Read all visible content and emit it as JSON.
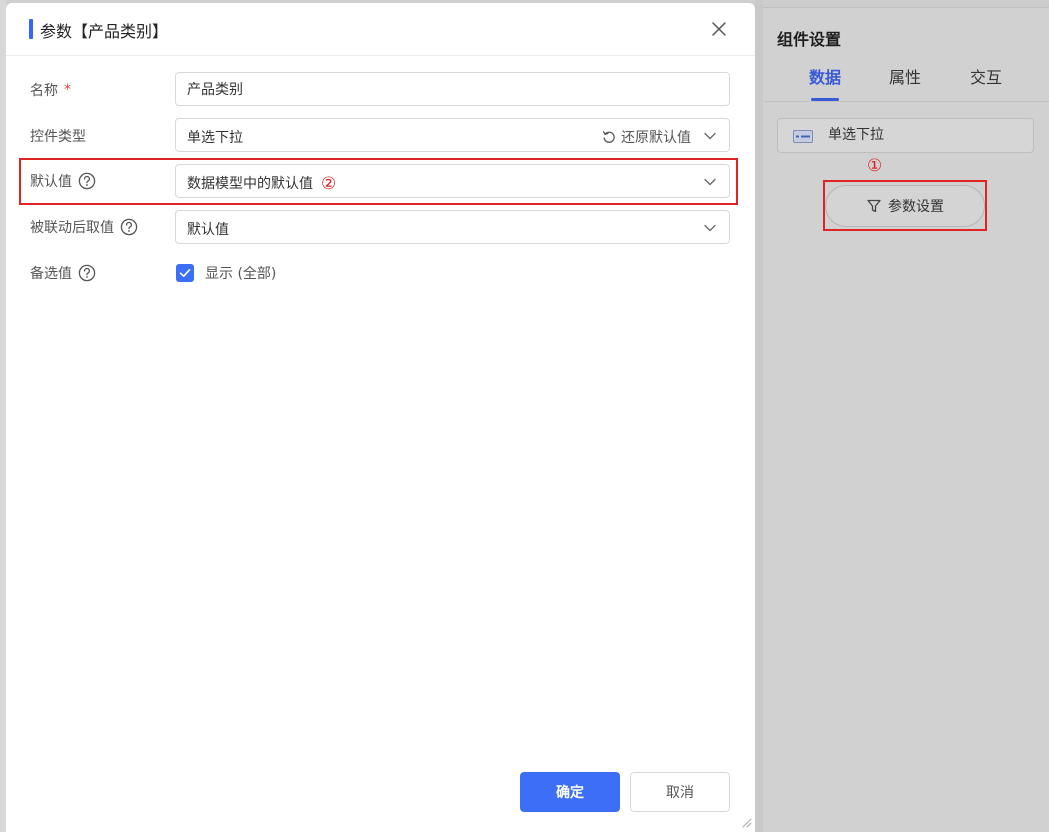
{
  "dialog": {
    "title": "参数【产品类别】",
    "fields": {
      "name": {
        "label": "名称",
        "required_mark": "*",
        "value": "产品类别"
      },
      "control_type": {
        "label": "控件类型",
        "value": "单选下拉",
        "restore_label": "还原默认值"
      },
      "default_value": {
        "label": "默认值",
        "value": "数据模型中的默认值",
        "marker": "②"
      },
      "linked_value": {
        "label": "被联动后取值",
        "value": "默认值"
      },
      "options": {
        "label": "备选值",
        "checkbox_label": "显示 (全部)",
        "checked": true
      }
    },
    "buttons": {
      "confirm": "确定",
      "cancel": "取消"
    }
  },
  "side_panel": {
    "title": "组件设置",
    "tabs": [
      {
        "label": "数据",
        "active": true
      },
      {
        "label": "属性",
        "active": false
      },
      {
        "label": "交互",
        "active": false
      }
    ],
    "widget_type": "单选下拉",
    "marker": "①",
    "param_button": "参数设置"
  },
  "colors": {
    "primary": "#3d6ef6",
    "accent_tab": "#3b5ad6",
    "highlight": "#e02424",
    "required": "#e64545"
  },
  "icons": [
    "close-icon",
    "help-icon",
    "chevron-down-icon",
    "restore-icon",
    "check-icon",
    "filter-icon",
    "widget-dropdown-icon",
    "resize-handle-icon"
  ]
}
